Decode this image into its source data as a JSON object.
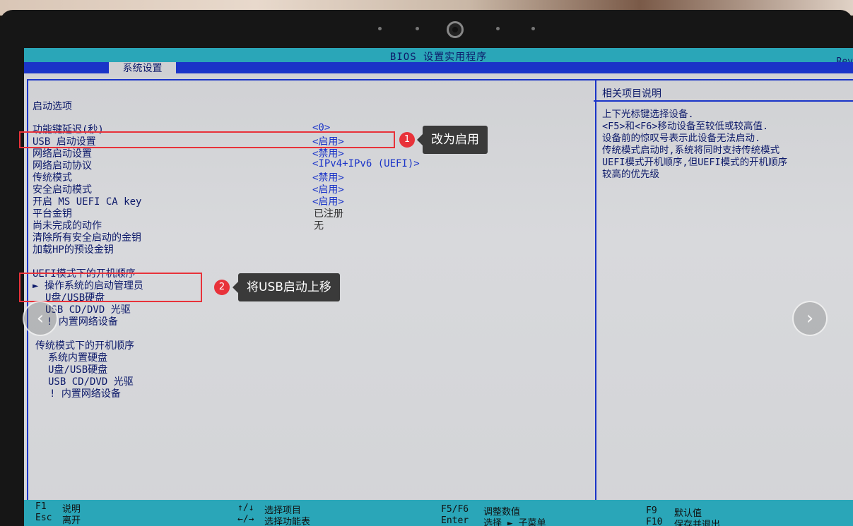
{
  "bios": {
    "title": "BIOS 设置实用程序",
    "rev": "Rev",
    "tab": "系统设置"
  },
  "left": {
    "section_boot_options": "启动选项",
    "items": [
      {
        "label": "功能键延迟(秒)",
        "value": "<0>"
      },
      {
        "label": "USB 启动设置",
        "value": "<启用>"
      },
      {
        "label": "网络启动设置",
        "value": "<禁用>"
      },
      {
        "label": "网络启动协议",
        "value": "<IPv4+IPv6 (UEFI)>"
      },
      {
        "label": "传统模式",
        "value": "<禁用>"
      },
      {
        "label": "安全启动模式",
        "value": "<启用>"
      },
      {
        "label": "开启 MS UEFI CA key",
        "value": "<启用>"
      },
      {
        "label": "平台金钥",
        "value": "已注册"
      },
      {
        "label": "尚未完成的动作",
        "value": "无"
      },
      {
        "label": "清除所有安全启动的金钥",
        "value": ""
      },
      {
        "label": "加载HP的预设金钥",
        "value": ""
      }
    ],
    "uefi_order_title": "UEFI模式下的开机顺序",
    "uefi_order": [
      "► 操作系统的启动管理员",
      "U盘/USB硬盘",
      "USB CD/DVD 光驱",
      "! 内置网络设备"
    ],
    "legacy_order_title": "传统模式下的开机顺序",
    "legacy_order": [
      "系统内置硬盘",
      "U盘/USB硬盘",
      "USB CD/DVD 光驱",
      "! 内置网络设备"
    ]
  },
  "help": {
    "title": "相关项目说明",
    "lines": [
      "上下光标键选择设备.",
      "<F5>和<F6>移动设备至较低或较高值.",
      "设备前的惊叹号表示此设备无法启动.",
      "传统模式启动时,系统将同时支持传统模式",
      "UEFI模式开机顺序,但UEFI模式的开机顺序",
      "较高的优先级"
    ]
  },
  "footer": {
    "f1_key": "F1",
    "f1_label": "说明",
    "esc_key": "Esc",
    "esc_label": "离开",
    "updown_key": "↑/↓",
    "updown_label": "选择项目",
    "leftright_key": "←/→",
    "leftright_label": "选择功能表",
    "f5f6_key": "F5/F6",
    "f5f6_label": "调整数值",
    "enter_key": "Enter",
    "enter_label": "选择 ► 子菜单",
    "f9_key": "F9",
    "f9_label": "默认值",
    "f10_key": "F10",
    "f10_label": "保存并退出"
  },
  "annotations": {
    "badge1": "1",
    "tip1": "改为启用",
    "badge2": "2",
    "tip2": "将USB启动上移",
    "color": "#e8323a"
  },
  "nav": {
    "prev": "‹",
    "next": "›"
  }
}
